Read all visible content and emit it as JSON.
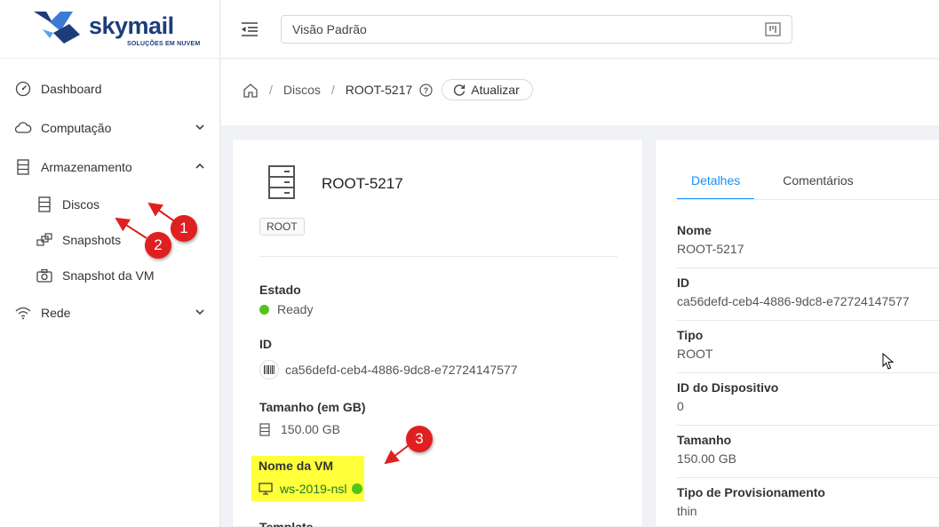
{
  "brand": {
    "name": "skymail",
    "tagline": "SOLUÇÕES EM NUVEM"
  },
  "sidebar": {
    "items": [
      {
        "label": "Dashboard",
        "icon": "dashboard-icon"
      },
      {
        "label": "Computação",
        "icon": "cloud-icon",
        "expanded": false
      },
      {
        "label": "Armazenamento",
        "icon": "storage-icon",
        "expanded": true
      },
      {
        "label": "Rede",
        "icon": "wifi-icon",
        "expanded": false
      }
    ],
    "storage_sub": [
      {
        "label": "Discos",
        "icon": "disk-icon"
      },
      {
        "label": "Snapshots",
        "icon": "snapshots-icon"
      },
      {
        "label": "Snapshot da VM",
        "icon": "camera-icon"
      }
    ]
  },
  "topbar": {
    "view": "Visão Padrão"
  },
  "breadcrumb": {
    "section": "Discos",
    "current": "ROOT-5217",
    "refresh": "Atualizar"
  },
  "disk": {
    "name": "ROOT-5217",
    "tag": "ROOT",
    "state_label": "Estado",
    "state": "Ready",
    "id_label": "ID",
    "id": "ca56defd-ceb4-4886-9dc8-e72724147577",
    "size_label": "Tamanho (em GB)",
    "size": "150.00 GB",
    "vm_label": "Nome da VM",
    "vm": "ws-2019-nsl",
    "template_label": "Template"
  },
  "details": {
    "tabs": [
      "Detalhes",
      "Comentários"
    ],
    "rows": [
      {
        "key": "Nome",
        "value": "ROOT-5217"
      },
      {
        "key": "ID",
        "value": "ca56defd-ceb4-4886-9dc8-e72724147577"
      },
      {
        "key": "Tipo",
        "value": "ROOT"
      },
      {
        "key": "ID do Dispositivo",
        "value": "0"
      },
      {
        "key": "Tamanho",
        "value": "150.00 GB"
      },
      {
        "key": "Tipo de Provisionamento",
        "value": "thin"
      }
    ]
  },
  "annotations": [
    "1",
    "2",
    "3"
  ],
  "colors": {
    "accent": "#1890ff",
    "status_ok": "#52c41a",
    "highlight": "#ffff3a",
    "badge": "#e02020",
    "brand": "#1d3d7a"
  }
}
